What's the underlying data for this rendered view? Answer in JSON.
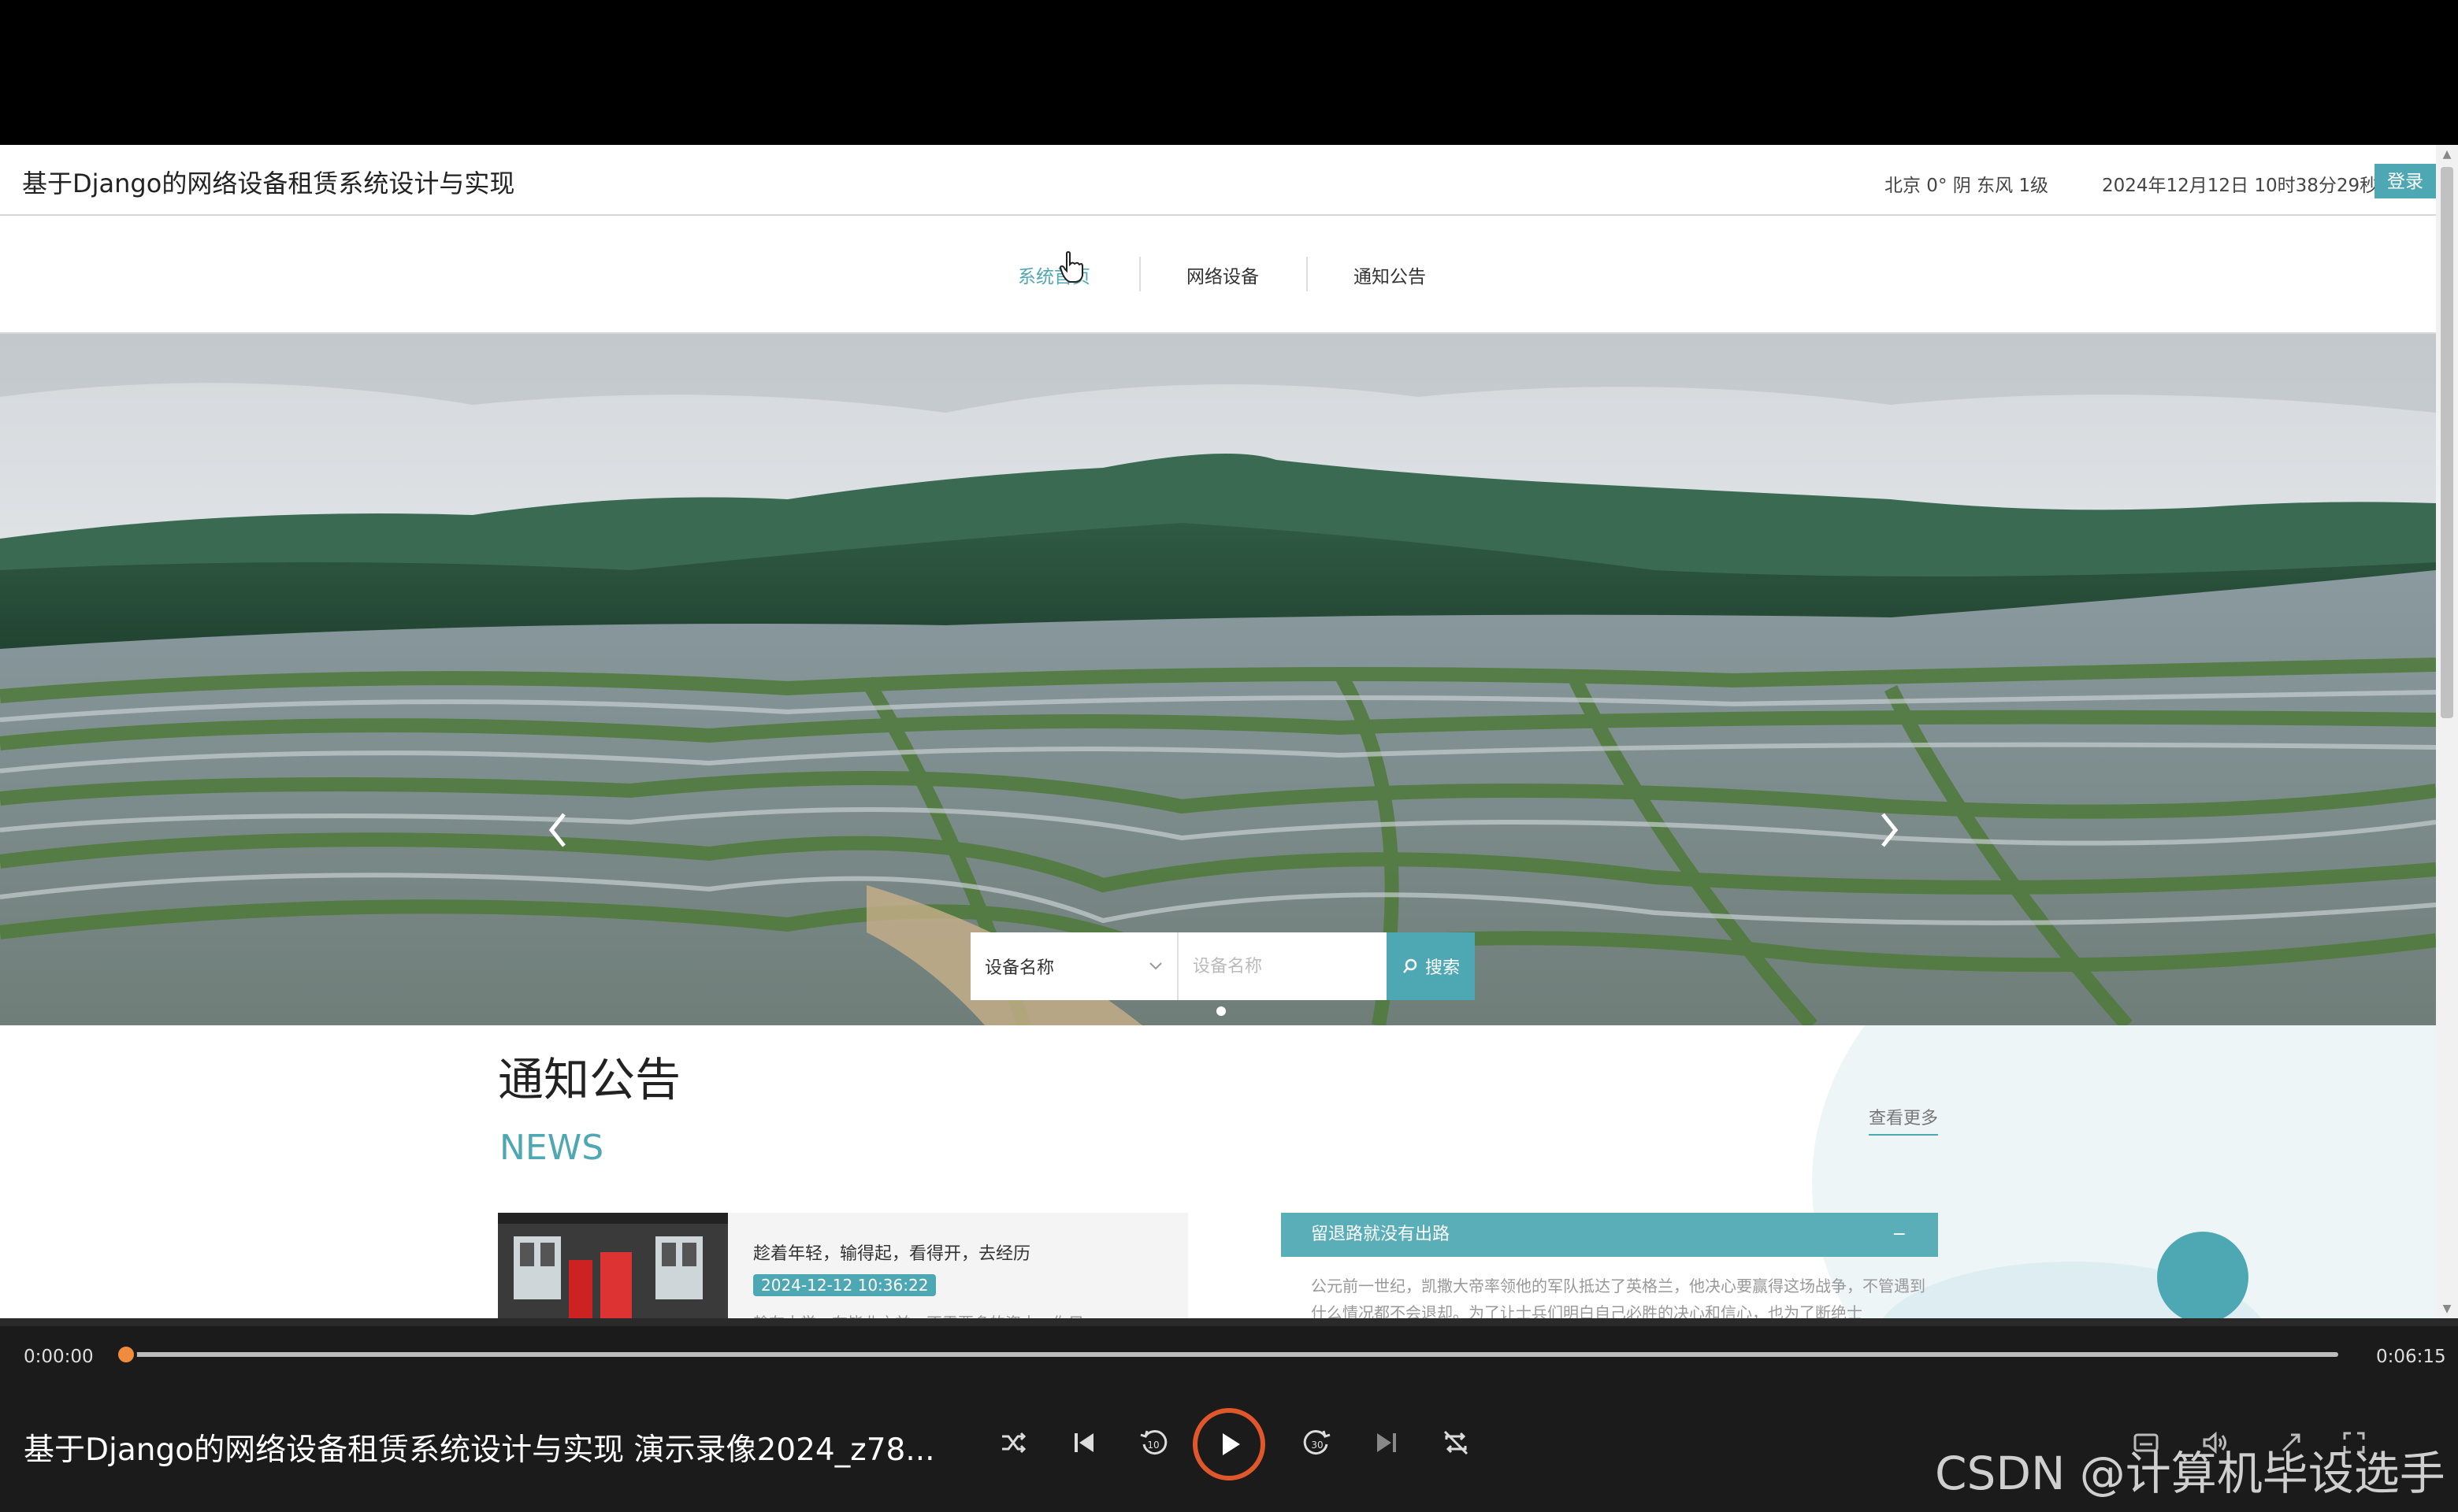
{
  "site": {
    "title": "基于Django的网络设备租赁系统设计与实现",
    "weather": "北京  0°  阴  东风  1级",
    "datetime": "2024年12月12日 10时38分29秒",
    "login_label": "登录"
  },
  "nav": {
    "items": [
      {
        "label": "系统首页",
        "active": true
      },
      {
        "label": "网络设备",
        "active": false
      },
      {
        "label": "通知公告",
        "active": false
      }
    ]
  },
  "search": {
    "select_value": "设备名称",
    "placeholder": "设备名称",
    "button_label": "搜索"
  },
  "news": {
    "title": "通知公告",
    "subtitle": "NEWS",
    "more_label": "查看更多",
    "card": {
      "title": "趁着年轻，输得起，看得开，去经历",
      "date": "2024-12-12 10:36:22",
      "snippet": "趁在大学，在毕业之前，不需要多的资本，你只"
    },
    "accordion": {
      "title": "留退路就没有出路",
      "toggle": "−",
      "body": "公元前一世纪，凯撒大帝率领他的军队抵达了英格兰，他决心要赢得这场战争，不管遇到什么情况都不会退却。为了让士兵们明白自己必胜的决心和信心，也为了断绝士"
    }
  },
  "player": {
    "current_time": "0:00:00",
    "total_time": "0:06:15",
    "progress": 0.0,
    "title": "基于Django的网络设备租赁系统设计与实现 演示录像2024_z78...",
    "watermark": "CSDN @计算机毕设选手"
  },
  "colors": {
    "accent": "#4ea8b4",
    "progress": "#f08a3c",
    "play_ring": "#e0572b"
  }
}
